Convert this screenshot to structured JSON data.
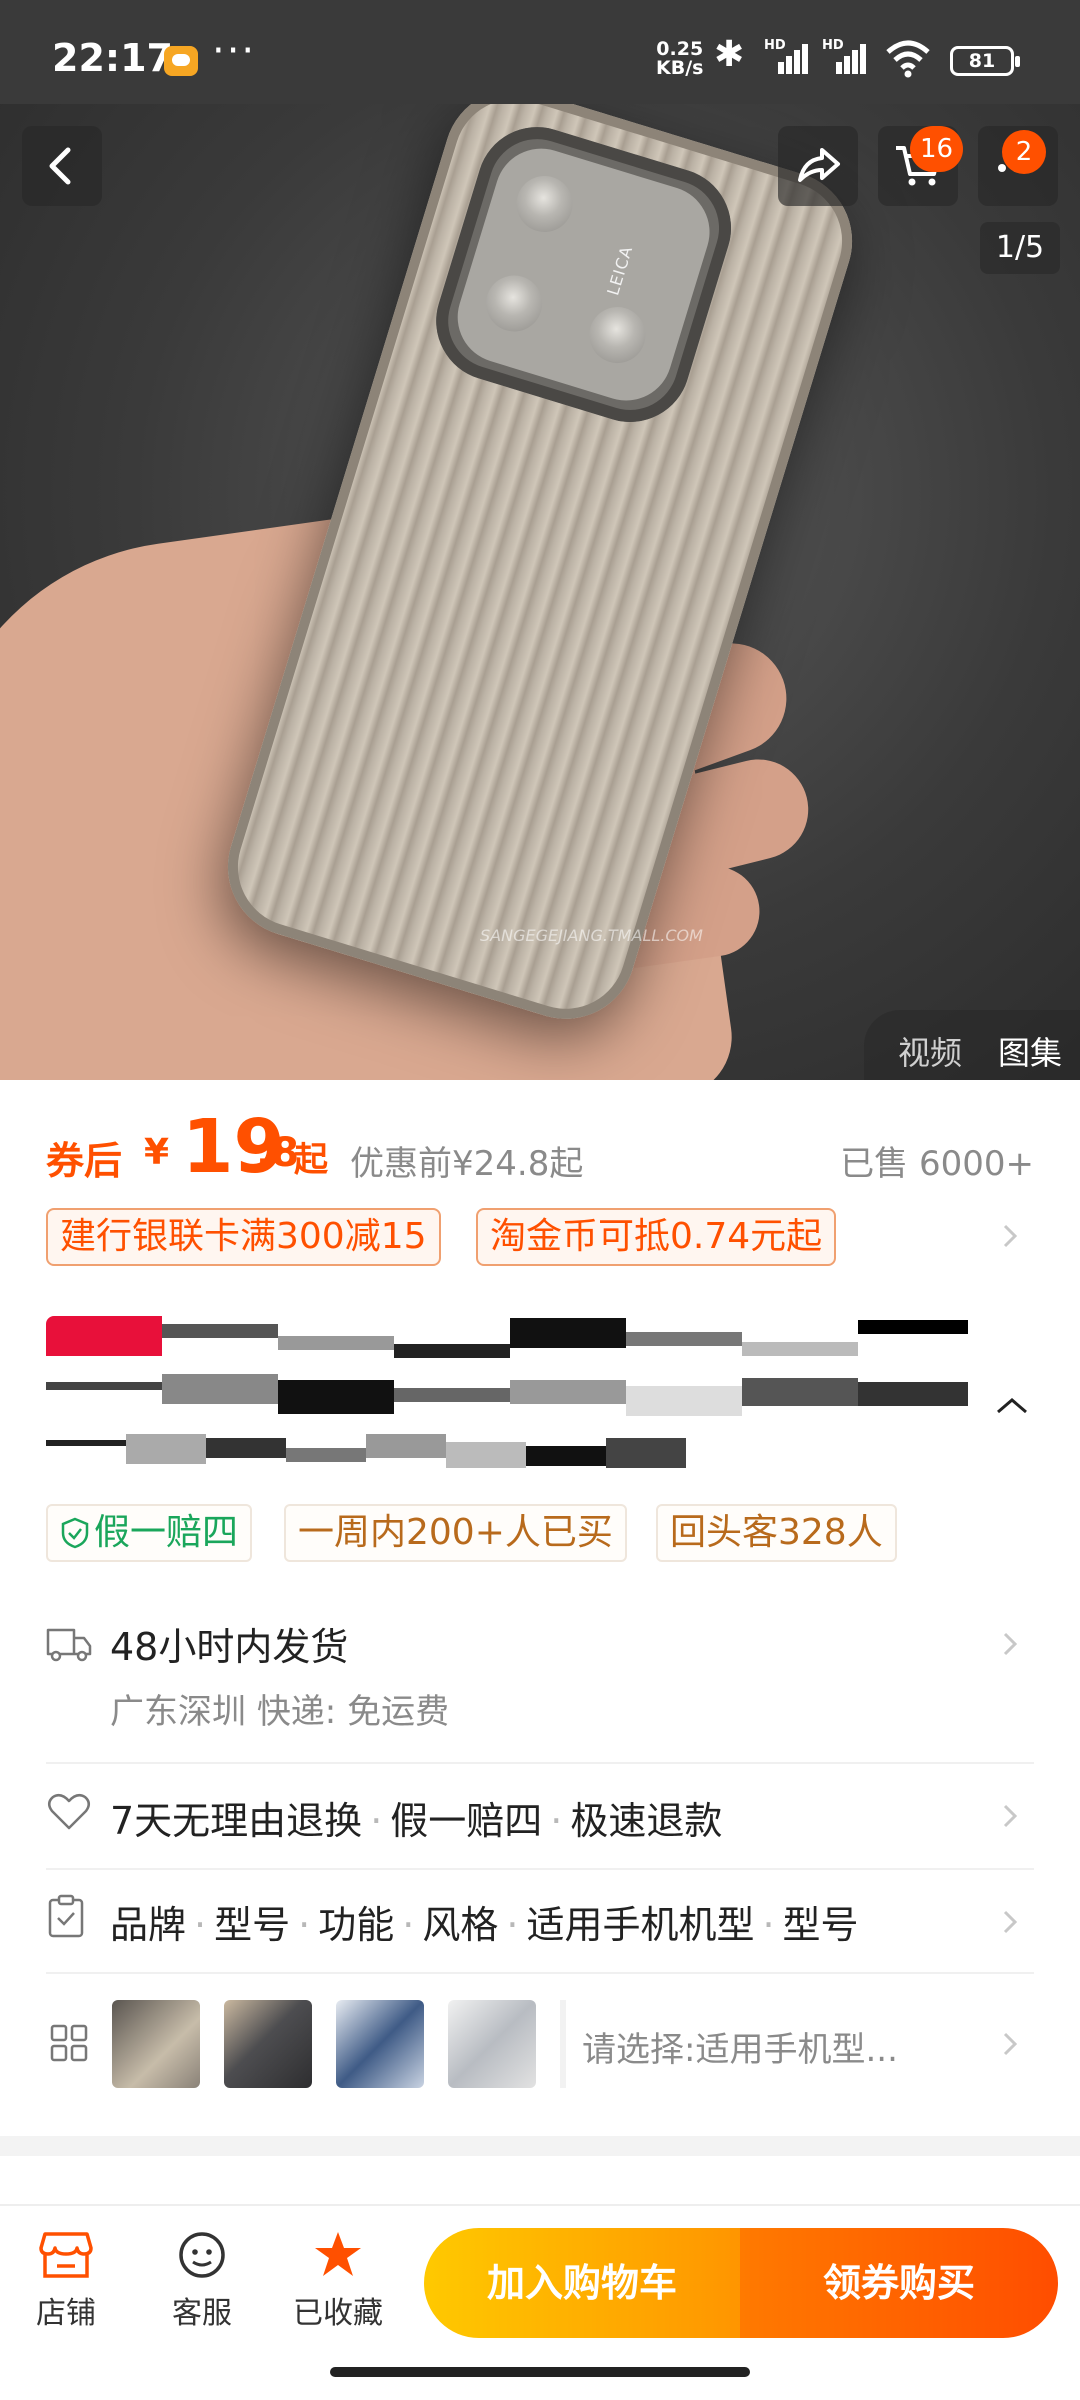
{
  "status": {
    "time": "22:17",
    "net_speed_top": "0.25",
    "net_speed_unit": "KB/s",
    "signal1_label": "HD",
    "signal2_label": "HD",
    "battery": "81"
  },
  "gallery": {
    "cart_badge": "16",
    "more_badge": "2",
    "counter": "1/5",
    "tab_video": "视频",
    "tab_album": "图集",
    "watermark": "SANGEGEJIANG.TMALL.COM",
    "lens_brand": "LEICA"
  },
  "price": {
    "label": "券后",
    "currency": "¥",
    "amount_int": "19",
    "amount_dec": ".8",
    "suffix": "起",
    "before_label": "优惠前",
    "before_price": "¥24.8起",
    "sold": "已售 6000+"
  },
  "coupons": [
    "建行银联卡满300减15",
    "淘金币可抵0.74元起"
  ],
  "tags": {
    "guarantee": "假一赔四",
    "weekly": "一周内200+人已买",
    "repeat": "回头客328人"
  },
  "shipping": {
    "title": "48小时内发货",
    "origin": "广东深圳",
    "express_label": "快递:",
    "express_value": "免运费"
  },
  "service": {
    "items": [
      "7天无理由退换",
      "假一赔四",
      "极速退款"
    ]
  },
  "params": {
    "items": [
      "品牌",
      "型号",
      "功能",
      "风格",
      "适用手机机型",
      "型号"
    ]
  },
  "sku": {
    "prompt": "请选择:适用手机型..."
  },
  "bottom": {
    "shop": "店铺",
    "service": "客服",
    "favorite": "已收藏",
    "add_cart": "加入购物车",
    "buy": "领券购买"
  },
  "colors": {
    "accent": "#ff5000",
    "cart_gradient_start": "#ffc900",
    "buy_gradient_end": "#ff4d00",
    "guarantee_green": "#1aa65b"
  }
}
